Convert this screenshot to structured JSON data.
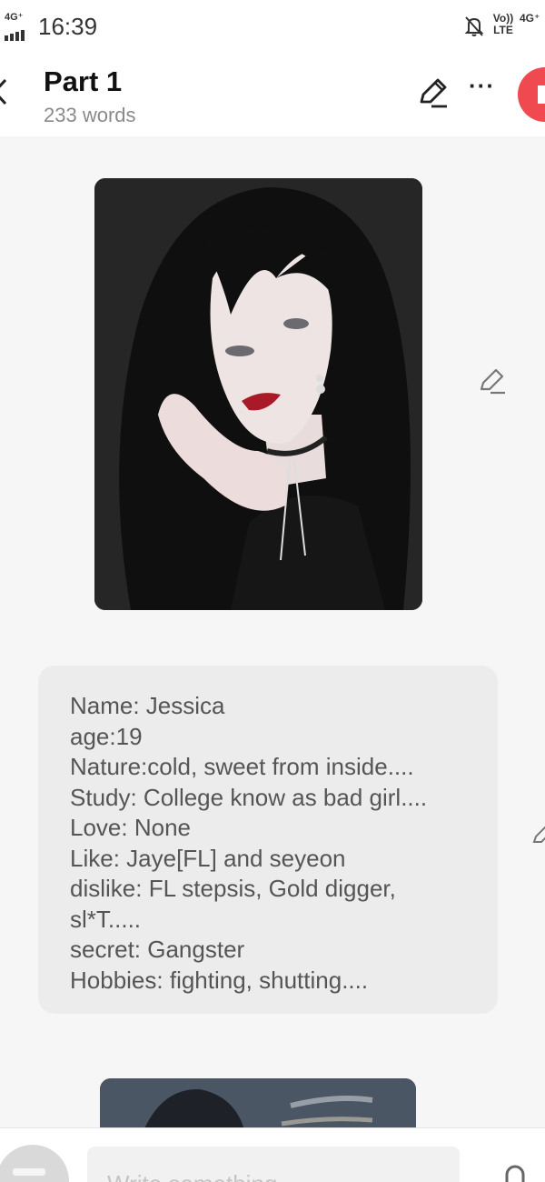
{
  "status_bar": {
    "network_left": "4G⁺",
    "time": "16:39",
    "volte_label": "Vo)) LTE",
    "network_right": "4G⁺",
    "icons": [
      "signal-icon",
      "bell-off-icon",
      "volte-icon",
      "4g-icon"
    ]
  },
  "header": {
    "title": "Part 1",
    "word_count": "233 words",
    "icons": [
      "back-icon",
      "edit-icon",
      "more-icon",
      "publish-icon"
    ],
    "more_label": "···"
  },
  "content": {
    "profile_lines": [
      "Name: Jessica",
      "age:19",
      "Nature:cold, sweet from inside....",
      "Study: College know as bad girl....",
      "Love: None",
      "Like: Jaye[FL] and seyeon",
      "dislike: FL stepsis, Gold digger,",
      "sl*T.....",
      "secret: Gangster",
      "Hobbies: fighting, shutting...."
    ]
  },
  "composer": {
    "placeholder": "Write something..."
  },
  "colors": {
    "accent": "#f0494f",
    "background": "#f6f6f6",
    "card": "#ececec"
  }
}
